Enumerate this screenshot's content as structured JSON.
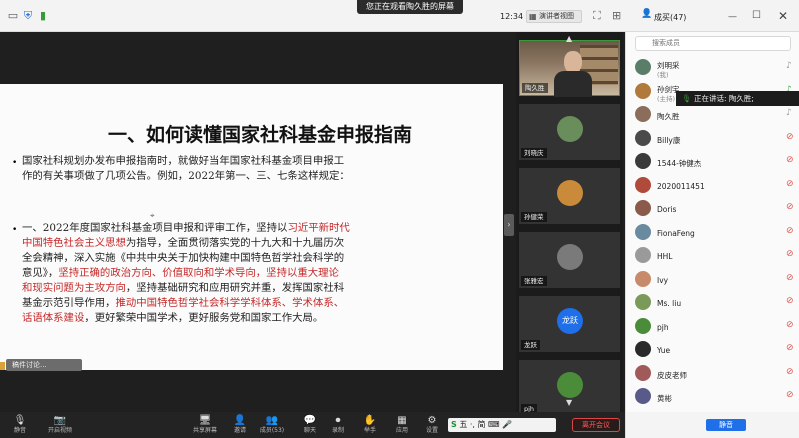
{
  "top_bar": {
    "viewing_banner": "您正在观看陶久胜的屏幕",
    "clock": "12:34",
    "view_toggle_label": "演讲者视图",
    "user": "成买(47)",
    "icons": [
      "minimize-icon",
      "shield-icon",
      "signal-icon",
      "grid-icon",
      "settings-icon",
      "pin-icon",
      "minimize-icon",
      "maximize-icon",
      "close-icon"
    ]
  },
  "slide": {
    "title": "一、如何读懂国家社科基金申报指南",
    "bullet1_lines": [
      "国家社科规划办发布申报指南时，就做好当年国家社科基金项目申报工",
      "作的有关事项做了几项公告。例如，2022年第一、三、七条这样规定："
    ],
    "bullet2_lines": [
      [
        {
          "t": "一、2022年度国家社科基金项目申报和评审工作，坚持以"
        },
        {
          "t": "习近平新时代",
          "red": true
        }
      ],
      [
        {
          "t": "中国特色社会主义思想",
          "red": true
        },
        {
          "t": "为指导，全面贯彻落实党的十九大和十九届历次"
        }
      ],
      [
        {
          "t": "全会精神，深入实施《中共中央关于加快构建中国特色哲学社会科学的"
        }
      ],
      [
        {
          "t": "意见》，"
        },
        {
          "t": "坚持正确的政治方向、价值取向和学术导向，坚持以重大理论",
          "red": true
        }
      ],
      [
        {
          "t": "和现实问题为主攻方向",
          "red": true
        },
        {
          "t": "，坚持基础研究和应用研究并重，发挥国家社科"
        }
      ],
      [
        {
          "t": "基金示范引导作用，"
        },
        {
          "t": "推动中国特色哲学社会科学学科体系、学术体系、",
          "red": true
        }
      ],
      [
        {
          "t": "话语体系建设",
          "red": true
        },
        {
          "t": "，更好繁荣中国学术，更好服务党和国家工作大局。"
        }
      ]
    ],
    "annotation_tag": "稿件讨论..."
  },
  "video_tiles": [
    {
      "label": "陶久胜",
      "type": "camera"
    },
    {
      "label": "刘晓庆",
      "type": "avatar",
      "color": "#6a8e5b"
    },
    {
      "label": "孙健荣",
      "type": "avatar",
      "color": "#c98a3a"
    },
    {
      "label": "张雅宏",
      "type": "avatar",
      "color": "#7a7a7a"
    },
    {
      "label": "龙跃",
      "type": "text-avatar",
      "avatar_text": "龙跃",
      "color": "#1e6fe8"
    },
    {
      "label": "pjh",
      "type": "avatar",
      "color": "#4a8c3a"
    }
  ],
  "panel": {
    "search_placeholder": "搜索成员",
    "speaking_text": "正在讲话: 陶久胜;",
    "participants": [
      {
        "name": "刘明采",
        "sub": "(我)",
        "color": "#5a7d6a",
        "mic": "grey"
      },
      {
        "name": "孙剑宇",
        "sub": "(主持)",
        "color": "#b07a3a",
        "mic": "green"
      },
      {
        "name": "陶久胜",
        "sub": "",
        "color": "#8a6d5a",
        "mic": "grey"
      },
      {
        "name": "Billy康",
        "sub": "",
        "color": "#4a4a4a",
        "mic": "red"
      },
      {
        "name": "1544-钟健杰",
        "sub": "",
        "color": "#3a3a3a",
        "mic": "red"
      },
      {
        "name": "2020011451",
        "sub": "",
        "color": "#b04a3a",
        "mic": "red"
      },
      {
        "name": "Doris",
        "sub": "",
        "color": "#8a5a4a",
        "mic": "red"
      },
      {
        "name": "FionaFeng",
        "sub": "",
        "color": "#6a8aa0",
        "mic": "red"
      },
      {
        "name": "HHL",
        "sub": "",
        "color": "#9a9a9a",
        "mic": "red"
      },
      {
        "name": "Ivy",
        "sub": "",
        "color": "#c78a6a",
        "mic": "red"
      },
      {
        "name": "Ms. liu",
        "sub": "",
        "color": "#7a9a5a",
        "mic": "red"
      },
      {
        "name": "pjh",
        "sub": "",
        "color": "#4a8c3a",
        "mic": "red"
      },
      {
        "name": "Yue",
        "sub": "",
        "color": "#2a2a2a",
        "mic": "red"
      },
      {
        "name": "皮皮老师",
        "sub": "",
        "color": "#a05a5a",
        "mic": "red"
      },
      {
        "name": "黄彬",
        "sub": "",
        "color": "#5a5a8a",
        "mic": "red"
      }
    ],
    "mute_all_label": "静音"
  },
  "toolbar": {
    "buttons": [
      {
        "label": "静音",
        "icon": "mic-icon",
        "glyph": "🎙"
      },
      {
        "label": "开启视频",
        "icon": "camera-icon",
        "glyph": "📷"
      },
      {
        "label": "共享屏幕",
        "icon": "share-screen-icon",
        "glyph": "🖥"
      },
      {
        "label": "邀请",
        "icon": "invite-icon",
        "glyph": "👤"
      },
      {
        "label": "成员(53)",
        "icon": "members-icon",
        "glyph": "👥"
      },
      {
        "label": "聊天",
        "icon": "chat-icon",
        "glyph": "💬"
      },
      {
        "label": "录制",
        "icon": "record-icon",
        "glyph": "⏺"
      },
      {
        "label": "举手",
        "icon": "raise-hand-icon",
        "glyph": "✋"
      },
      {
        "label": "应用",
        "icon": "apps-icon",
        "glyph": "▦"
      },
      {
        "label": "设置",
        "icon": "settings-icon",
        "glyph": "⚙"
      }
    ],
    "leave_label": "离开会议",
    "ime_text": "五 ·, 简 ⌨ 🎤"
  }
}
